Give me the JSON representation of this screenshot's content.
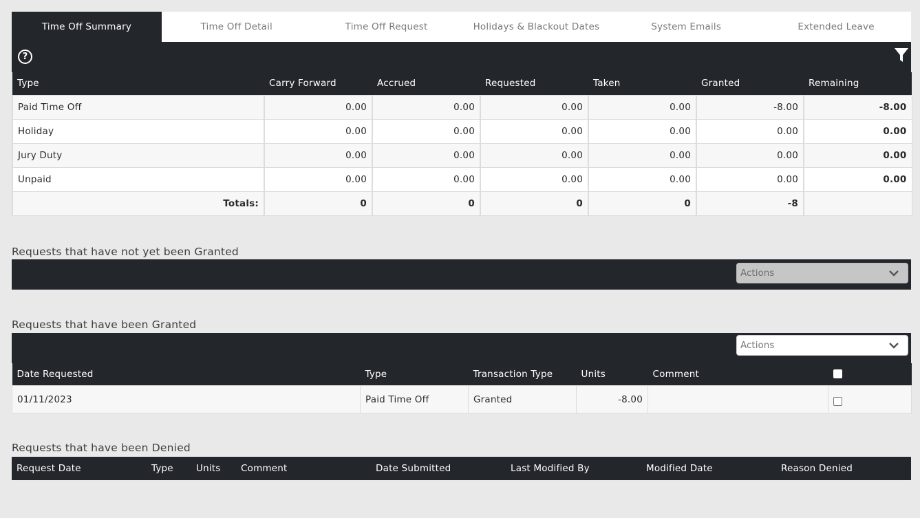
{
  "tabs": [
    "Time Off Summary",
    "Time Off Detail",
    "Time Off Request",
    "Holidays & Blackout Dates",
    "System Emails",
    "Extended Leave"
  ],
  "summary": {
    "headers": [
      "Type",
      "Carry Forward",
      "Accrued",
      "Requested",
      "Taken",
      "Granted",
      "Remaining"
    ],
    "rows": [
      [
        "Paid Time Off",
        "0.00",
        "0.00",
        "0.00",
        "0.00",
        "-8.00",
        "-8.00"
      ],
      [
        "Holiday",
        "0.00",
        "0.00",
        "0.00",
        "0.00",
        "0.00",
        "0.00"
      ],
      [
        "Jury Duty",
        "0.00",
        "0.00",
        "0.00",
        "0.00",
        "0.00",
        "0.00"
      ],
      [
        "Unpaid",
        "0.00",
        "0.00",
        "0.00",
        "0.00",
        "0.00",
        "0.00"
      ]
    ],
    "totals": [
      "Totals:",
      "0",
      "0",
      "0",
      "0",
      "-8",
      ""
    ]
  },
  "pending": {
    "title": "Requests that have not yet been Granted",
    "actions_label": "Actions"
  },
  "granted": {
    "title": "Requests that have been Granted",
    "actions_label": "Actions",
    "headers": [
      "Date Requested",
      "Type",
      "Transaction Type",
      "Units",
      "Comment"
    ],
    "rows": [
      [
        "01/11/2023",
        "Paid Time Off",
        "Granted",
        "-8.00",
        ""
      ]
    ]
  },
  "denied": {
    "title": "Requests that have been Denied",
    "headers": [
      "Request Date",
      "Type",
      "Units",
      "Comment",
      "Date Submitted",
      "Last Modified By",
      "Modified Date",
      "Reason Denied"
    ]
  },
  "icons": {
    "help": "help-circle-icon",
    "filter": "filter-icon",
    "dropdown": "chevron-down-icon"
  },
  "colors": {
    "dark": "#23262b",
    "background": "#e9e9e9"
  }
}
